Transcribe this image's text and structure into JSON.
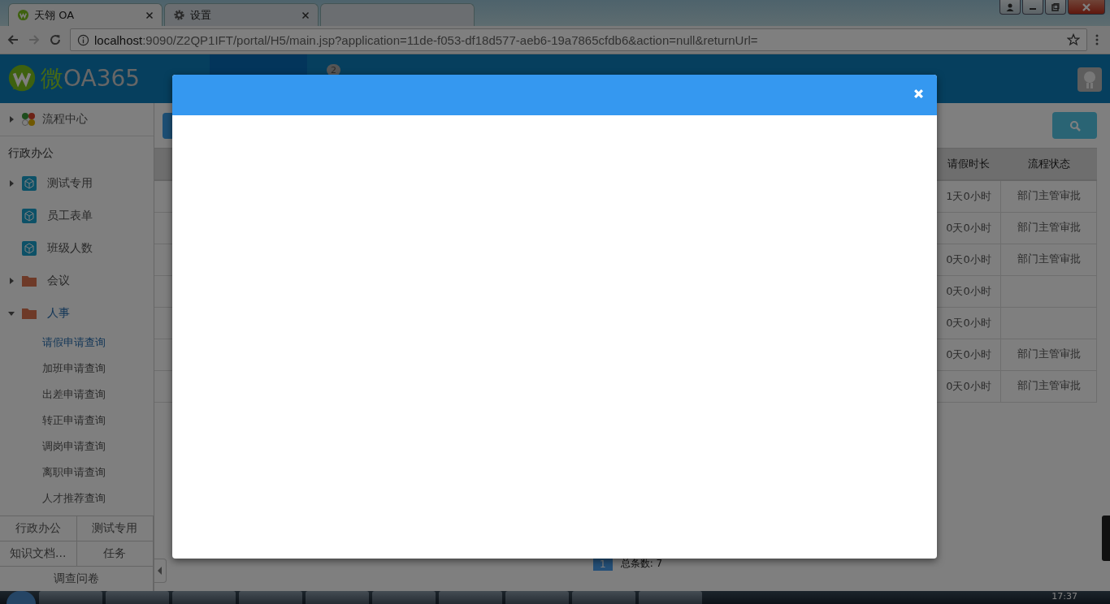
{
  "browser": {
    "tabs": [
      {
        "title": "天翎 OA",
        "selected": true
      },
      {
        "title": "设置",
        "selected": false
      },
      {
        "selected": false
      }
    ],
    "address": {
      "host": "localhost",
      "rest": ":9090/Z2QP1IFT/portal/H5/main.jsp?application=11de-f053-df18d577-aeb6-19a7865cfdb6&action=null&returnUrl="
    }
  },
  "header": {
    "logo_mark": "微",
    "logo_text": "OA365",
    "notification_count": "2"
  },
  "sidebar": {
    "top": {
      "label": "流程中心",
      "expanded": false
    },
    "section": "行政办公",
    "items": [
      {
        "label": "测试专用",
        "kind": "form",
        "expanded": false
      },
      {
        "label": "员工表单",
        "kind": "form"
      },
      {
        "label": "班级人数",
        "kind": "form"
      },
      {
        "label": "会议",
        "kind": "folder",
        "expanded": false
      },
      {
        "label": "人事",
        "kind": "folder",
        "expanded": true,
        "children": [
          {
            "label": "请假申请查询",
            "selected": true
          },
          {
            "label": "加班申请查询",
            "selected": false
          },
          {
            "label": "出差申请查询",
            "selected": false
          },
          {
            "label": "转正申请查询",
            "selected": false
          },
          {
            "label": "调岗申请查询",
            "selected": false
          },
          {
            "label": "离职申请查询",
            "selected": false
          },
          {
            "label": "人才推荐查询",
            "selected": false
          }
        ]
      }
    ],
    "bottom_tabs": [
      "行政办公",
      "测试专用",
      "知识文档...",
      "任务",
      "调查问卷"
    ]
  },
  "table": {
    "columns": [
      "请假时长",
      "流程状态"
    ],
    "rows": [
      {
        "duration": "1天0小时",
        "status": "部门主管审批"
      },
      {
        "duration": "0天0小时",
        "status": "部门主管审批"
      },
      {
        "duration": "0天0小时",
        "status": "部门主管审批"
      },
      {
        "duration": "0天0小时"
      },
      {
        "duration": "0天0小时"
      },
      {
        "duration": "0天0小时",
        "status": "部门主管审批"
      },
      {
        "duration": "0天0小时",
        "status": "部门主管审批"
      }
    ]
  },
  "pagination": {
    "page": "1",
    "total": "总条数: 7"
  },
  "taskbar": {
    "clock": "17:37"
  }
}
